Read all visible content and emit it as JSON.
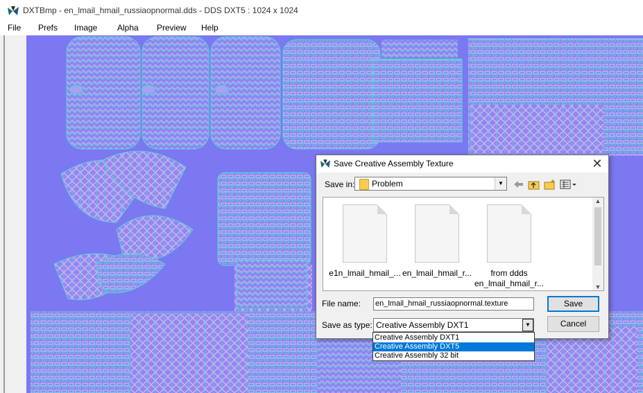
{
  "window": {
    "title": "DXTBmp - en_lmail_hmail_russiaopnormal.dds - DDS DXT5 : 1024 x 1024"
  },
  "menu": [
    "File",
    "Prefs",
    "Image",
    "Alpha",
    "Preview",
    "Help"
  ],
  "canvas": {
    "background_color": "#7b78f1"
  },
  "dialog": {
    "title": "Save Creative Assembly Texture",
    "save_in_label": "Save in:",
    "save_in_value": "Problem",
    "files": [
      {
        "name_line1": "e1n_lmail_hmail_...",
        "name_line2": ""
      },
      {
        "name_line1": "en_lmail_hmail_r...",
        "name_line2": ""
      },
      {
        "name_line1": "from ddds",
        "name_line2": "en_lmail_hmail_r..."
      }
    ],
    "file_name_label": "File name:",
    "file_name_value": "en_lmail_hmail_russiaopnormal.texture",
    "save_as_type_label": "Save as type:",
    "save_as_type_value": "Creative Assembly DXT1",
    "save_button": "Save",
    "cancel_button": "Cancel",
    "close_glyph": "✕",
    "type_options": [
      "Creative Assembly DXT1",
      "Creative Assembly DXT5",
      "Creative Assembly 32 bit"
    ],
    "selected_option": "Creative Assembly DXT5"
  },
  "icons": {
    "app": "dxtbmp-app-icon",
    "back": "back-arrow-icon",
    "up": "up-folder-icon",
    "new_folder": "new-folder-icon",
    "view": "view-menu-icon"
  }
}
